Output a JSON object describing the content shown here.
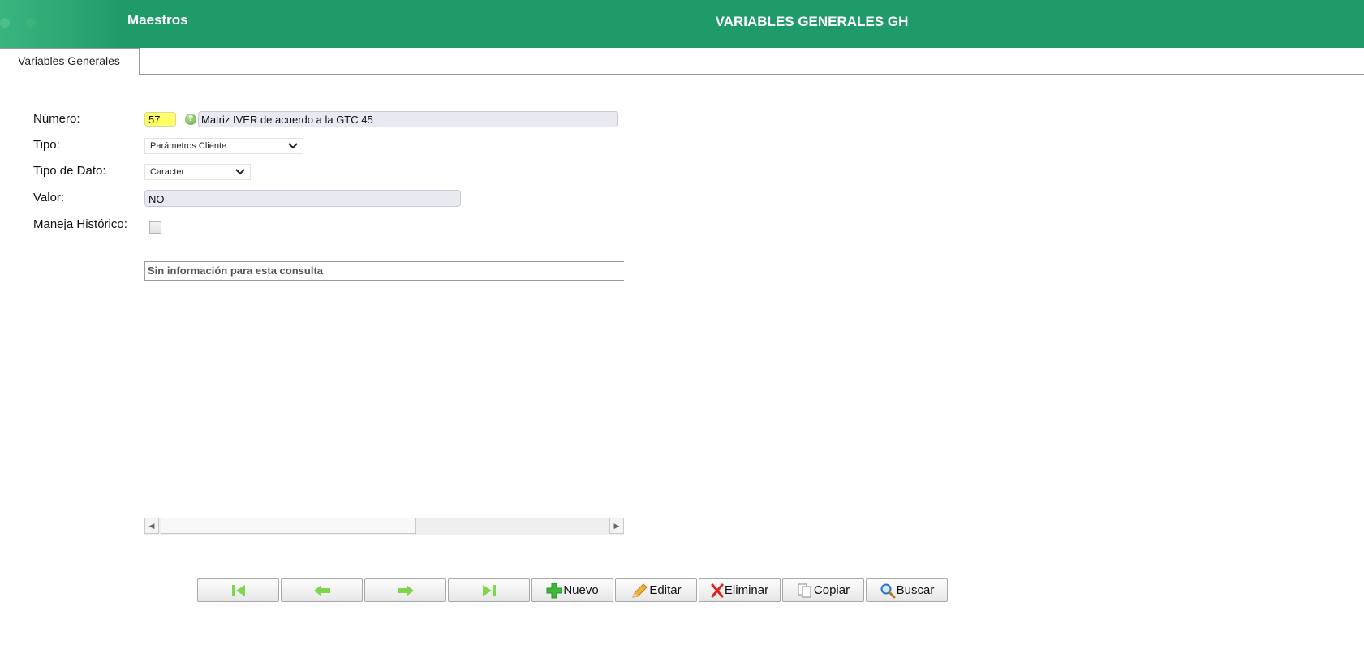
{
  "header": {
    "app_title": "Maestros",
    "page_title": "VARIABLES GENERALES GH",
    "brand_color": "#1f9b6a"
  },
  "tabs": [
    {
      "label": "Variables Generales",
      "active": true
    }
  ],
  "form": {
    "numero_label": "Número:",
    "numero_value": "57",
    "numero_description": "Matriz IVER de acuerdo a la GTC 45",
    "tipo_label": "Tipo:",
    "tipo_value": "Parámetros Cliente",
    "tipo_dato_label": "Tipo de Dato:",
    "tipo_dato_value": "Caracter",
    "valor_label": "Valor:",
    "valor_value": "NO",
    "historico_label": "Maneja Histórico:",
    "historico_checked": false
  },
  "grid": {
    "empty_message": "Sin información para esta consulta"
  },
  "toolbar": {
    "first_icon": "first-record-icon",
    "prev_icon": "previous-record-icon",
    "next_icon": "next-record-icon",
    "last_icon": "last-record-icon",
    "nuevo_label": "Nuevo",
    "editar_label": "Editar",
    "eliminar_label": "Eliminar",
    "copiar_label": "Copiar",
    "buscar_label": "Buscar"
  }
}
